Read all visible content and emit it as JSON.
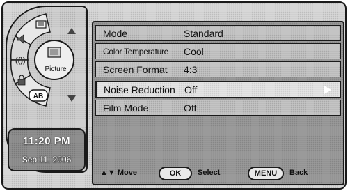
{
  "nav": {
    "current_category": "Picture",
    "category_icons": [
      "tv-icon",
      "speaker-icon",
      "antenna-icon",
      "picture-icon",
      "lock-icon",
      "ab-icon"
    ],
    "ab_label": "AB"
  },
  "clock": {
    "time": "11:20 PM",
    "date": "Sep.11, 2006"
  },
  "menu": {
    "rows": [
      {
        "label": "Mode",
        "value": "Standard"
      },
      {
        "label": "Color Temperature",
        "value": "Cool"
      },
      {
        "label": "Screen Format",
        "value": "4:3"
      },
      {
        "label": "Noise Reduction",
        "value": "Off"
      },
      {
        "label": "Film Mode",
        "value": "Off"
      }
    ],
    "selected_index": 3
  },
  "footer": {
    "move_label": "▲▼ Move",
    "ok_key": "OK",
    "select_label": "Select",
    "menu_key": "MENU",
    "back_label": "Back"
  }
}
